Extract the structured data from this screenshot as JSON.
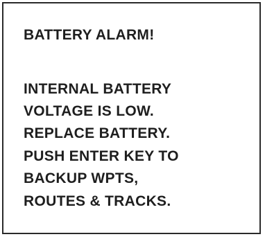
{
  "dialog": {
    "title": "BATTERY ALARM!",
    "message_lines": [
      "INTERNAL BATTERY",
      "VOLTAGE IS LOW.",
      "REPLACE BATTERY.",
      "PUSH ENTER KEY TO",
      "BACKUP WPTS,",
      "ROUTES & TRACKS."
    ]
  }
}
